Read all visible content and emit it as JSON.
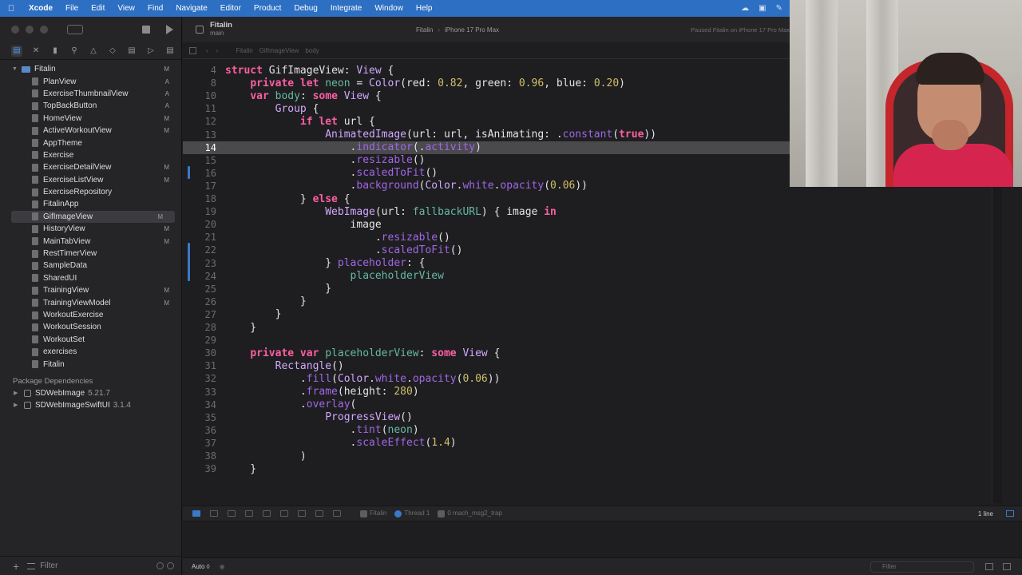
{
  "menubar": {
    "app": "Xcode",
    "items": [
      "File",
      "Edit",
      "View",
      "Find",
      "Navigate",
      "Editor",
      "Product",
      "Debug",
      "Integrate",
      "Window",
      "Help"
    ]
  },
  "navigator": {
    "root": {
      "label": "Fitalin",
      "status": "M"
    },
    "files": [
      {
        "label": "PlanView",
        "status": "A"
      },
      {
        "label": "ExerciseThumbnailView",
        "status": "A"
      },
      {
        "label": "TopBackButton",
        "status": "A"
      },
      {
        "label": "HomeView",
        "status": "M"
      },
      {
        "label": "ActiveWorkoutView",
        "status": "M"
      },
      {
        "label": "AppTheme",
        "status": ""
      },
      {
        "label": "Exercise",
        "status": ""
      },
      {
        "label": "ExerciseDetailView",
        "status": "M"
      },
      {
        "label": "ExerciseListView",
        "status": "M"
      },
      {
        "label": "ExerciseRepository",
        "status": ""
      },
      {
        "label": "FitalinApp",
        "status": ""
      },
      {
        "label": "GifImageView",
        "status": "M"
      },
      {
        "label": "HistoryView",
        "status": "M"
      },
      {
        "label": "MainTabView",
        "status": "M"
      },
      {
        "label": "RestTimerView",
        "status": ""
      },
      {
        "label": "SampleData",
        "status": ""
      },
      {
        "label": "SharedUI",
        "status": ""
      },
      {
        "label": "TrainingView",
        "status": "M"
      },
      {
        "label": "TrainingViewModel",
        "status": "M"
      },
      {
        "label": "WorkoutExercise",
        "status": ""
      },
      {
        "label": "WorkoutSession",
        "status": ""
      },
      {
        "label": "WorkoutSet",
        "status": ""
      },
      {
        "label": "exercises",
        "status": ""
      },
      {
        "label": "Fitalin",
        "status": ""
      }
    ],
    "selected_file": "GifImageView",
    "packages_header": "Package Dependencies",
    "packages": [
      {
        "name": "SDWebImage",
        "version": "5.21.7"
      },
      {
        "name": "SDWebImageSwiftUI",
        "version": "3.1.4"
      }
    ],
    "filter_placeholder": "Filter"
  },
  "editor_header": {
    "project": "Fitalin",
    "branch": "main",
    "scheme": "Fitalin",
    "destination": "iPhone 17 Pro Max",
    "run_status": "Paused Fitalin on iPhone 17 Pro Max"
  },
  "jumpbar": {
    "crumbs": [
      "Fitalin",
      "GifImageView",
      "body"
    ]
  },
  "code": {
    "current_line": 14,
    "lines": [
      {
        "n": "4",
        "t": [
          [
            "k",
            "struct "
          ],
          [
            "p",
            "GifImageView: "
          ],
          [
            "t",
            "View"
          ],
          [
            "p",
            " {"
          ]
        ]
      },
      {
        "n": "8",
        "t": [
          [
            "p",
            "    "
          ],
          [
            "k",
            "private let "
          ],
          [
            "v",
            "neon"
          ],
          [
            "p",
            " = "
          ],
          [
            "t",
            "Color"
          ],
          [
            "p",
            "(red: "
          ],
          [
            "n",
            "0.82"
          ],
          [
            "p",
            ", green: "
          ],
          [
            "n",
            "0.96"
          ],
          [
            "p",
            ", blue: "
          ],
          [
            "n",
            "0.20"
          ],
          [
            "p",
            ")"
          ]
        ]
      },
      {
        "n": "10",
        "t": [
          [
            "p",
            "    "
          ],
          [
            "k",
            "var "
          ],
          [
            "v",
            "body"
          ],
          [
            "p",
            ": "
          ],
          [
            "k",
            "some "
          ],
          [
            "t",
            "View"
          ],
          [
            "p",
            " {"
          ]
        ]
      },
      {
        "n": "11",
        "t": [
          [
            "p",
            "        "
          ],
          [
            "t",
            "Group"
          ],
          [
            "p",
            " {"
          ]
        ]
      },
      {
        "n": "12",
        "t": [
          [
            "p",
            "            "
          ],
          [
            "k",
            "if let "
          ],
          [
            "p",
            "url {"
          ]
        ]
      },
      {
        "n": "13",
        "t": [
          [
            "p",
            "                "
          ],
          [
            "t",
            "AnimatedImage"
          ],
          [
            "p",
            "(url: url, isAnimating: ."
          ],
          [
            "m",
            "constant"
          ],
          [
            "p",
            "("
          ],
          [
            "k",
            "true"
          ],
          [
            "p",
            "))"
          ]
        ]
      },
      {
        "n": "14",
        "t": [
          [
            "p",
            "                    ."
          ],
          [
            "m",
            "indicator"
          ],
          [
            "p",
            "(."
          ],
          [
            "m",
            "activity"
          ],
          [
            "p",
            ")"
          ]
        ]
      },
      {
        "n": "15",
        "t": [
          [
            "p",
            "                    ."
          ],
          [
            "m",
            "resizable"
          ],
          [
            "p",
            "()"
          ]
        ]
      },
      {
        "n": "16",
        "t": [
          [
            "p",
            "                    ."
          ],
          [
            "m",
            "scaledToFit"
          ],
          [
            "p",
            "()"
          ]
        ]
      },
      {
        "n": "17",
        "t": [
          [
            "p",
            "                    ."
          ],
          [
            "m",
            "background"
          ],
          [
            "p",
            "("
          ],
          [
            "t",
            "Color"
          ],
          [
            "p",
            "."
          ],
          [
            "m",
            "white"
          ],
          [
            "p",
            "."
          ],
          [
            "m",
            "opacity"
          ],
          [
            "p",
            "("
          ],
          [
            "n",
            "0.06"
          ],
          [
            "p",
            "))"
          ]
        ]
      },
      {
        "n": "18",
        "t": [
          [
            "p",
            "            } "
          ],
          [
            "k",
            "else"
          ],
          [
            "p",
            " {"
          ]
        ]
      },
      {
        "n": "19",
        "t": [
          [
            "p",
            "                "
          ],
          [
            "t",
            "WebImage"
          ],
          [
            "p",
            "(url: "
          ],
          [
            "v",
            "fallbackURL"
          ],
          [
            "p",
            ") { image "
          ],
          [
            "k",
            "in"
          ]
        ]
      },
      {
        "n": "20",
        "t": [
          [
            "p",
            "                    image"
          ]
        ]
      },
      {
        "n": "21",
        "t": [
          [
            "p",
            "                        ."
          ],
          [
            "m",
            "resizable"
          ],
          [
            "p",
            "()"
          ]
        ]
      },
      {
        "n": "22",
        "t": [
          [
            "p",
            "                        ."
          ],
          [
            "m",
            "scaledToFit"
          ],
          [
            "p",
            "()"
          ]
        ]
      },
      {
        "n": "23",
        "t": [
          [
            "p",
            "                } "
          ],
          [
            "m",
            "placeholder"
          ],
          [
            "p",
            ": {"
          ]
        ]
      },
      {
        "n": "24",
        "t": [
          [
            "p",
            "                    "
          ],
          [
            "v",
            "placeholderView"
          ]
        ]
      },
      {
        "n": "25",
        "t": [
          [
            "p",
            "                }"
          ]
        ]
      },
      {
        "n": "26",
        "t": [
          [
            "p",
            "            }"
          ]
        ]
      },
      {
        "n": "27",
        "t": [
          [
            "p",
            "        }"
          ]
        ]
      },
      {
        "n": "28",
        "t": [
          [
            "p",
            "    }"
          ]
        ]
      },
      {
        "n": "29",
        "t": [
          [
            "p",
            ""
          ]
        ]
      },
      {
        "n": "30",
        "t": [
          [
            "p",
            "    "
          ],
          [
            "k",
            "private var "
          ],
          [
            "v",
            "placeholderView"
          ],
          [
            "p",
            ": "
          ],
          [
            "k",
            "some "
          ],
          [
            "t",
            "View"
          ],
          [
            "p",
            " {"
          ]
        ]
      },
      {
        "n": "31",
        "t": [
          [
            "p",
            "        "
          ],
          [
            "t",
            "Rectangle"
          ],
          [
            "p",
            "()"
          ]
        ]
      },
      {
        "n": "32",
        "t": [
          [
            "p",
            "            ."
          ],
          [
            "m",
            "fill"
          ],
          [
            "p",
            "("
          ],
          [
            "t",
            "Color"
          ],
          [
            "p",
            "."
          ],
          [
            "m",
            "white"
          ],
          [
            "p",
            "."
          ],
          [
            "m",
            "opacity"
          ],
          [
            "p",
            "("
          ],
          [
            "n",
            "0.06"
          ],
          [
            "p",
            "))"
          ]
        ]
      },
      {
        "n": "33",
        "t": [
          [
            "p",
            "            ."
          ],
          [
            "m",
            "frame"
          ],
          [
            "p",
            "(height: "
          ],
          [
            "n",
            "280"
          ],
          [
            "p",
            ")"
          ]
        ]
      },
      {
        "n": "34",
        "t": [
          [
            "p",
            "            ."
          ],
          [
            "m",
            "overlay"
          ],
          [
            "p",
            "("
          ]
        ]
      },
      {
        "n": "35",
        "t": [
          [
            "p",
            "                "
          ],
          [
            "t",
            "ProgressView"
          ],
          [
            "p",
            "()"
          ]
        ]
      },
      {
        "n": "36",
        "t": [
          [
            "p",
            "                    ."
          ],
          [
            "m",
            "tint"
          ],
          [
            "p",
            "("
          ],
          [
            "v",
            "neon"
          ],
          [
            "p",
            ")"
          ]
        ]
      },
      {
        "n": "37",
        "t": [
          [
            "p",
            "                    ."
          ],
          [
            "m",
            "scaleEffect"
          ],
          [
            "p",
            "("
          ],
          [
            "n",
            "1.4"
          ],
          [
            "p",
            ")"
          ]
        ]
      },
      {
        "n": "38",
        "t": [
          [
            "p",
            "            )"
          ]
        ]
      },
      {
        "n": "39",
        "t": [
          [
            "p",
            "    }"
          ]
        ]
      }
    ]
  },
  "debug_bar": {
    "crumbs": [
      "Fitalin",
      "Thread 1",
      "0 mach_msg2_trap"
    ],
    "line_count": "1 line"
  },
  "console": {
    "mode": "Auto ◊",
    "filter_placeholder": "Filter"
  },
  "colors": {
    "menubar": "#2d6fc2",
    "keyword": "#fc5fa3",
    "type": "#d0a8ff",
    "method": "#a167e6",
    "number": "#d0bf69",
    "property": "#67b7a4"
  }
}
